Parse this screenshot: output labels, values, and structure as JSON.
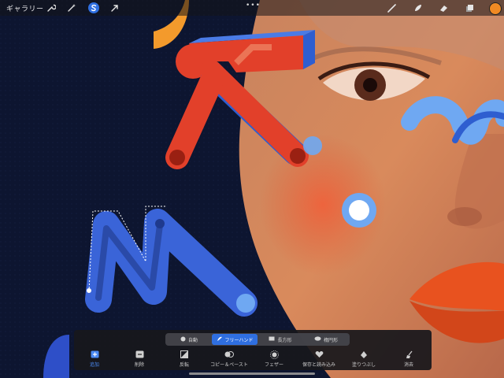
{
  "topbar": {
    "gallery_label": "ギャラリー",
    "more_label": "•••"
  },
  "icons": {
    "adjust": "wrench-icon",
    "actions": "magic-wand-icon",
    "selection": "selection-s-icon",
    "transform": "arrow-cursor-icon",
    "brush": "brush-icon",
    "smudge": "smudge-icon",
    "eraser": "eraser-icon",
    "layers": "layers-icon"
  },
  "colors": {
    "accent": "#2f6fe0",
    "current_color": "#f08a24"
  },
  "selection_modes": [
    {
      "label": "自動",
      "icon": "circle-icon",
      "active": false
    },
    {
      "label": "フリーハンド",
      "icon": "freehand-icon",
      "active": true
    },
    {
      "label": "長方形",
      "icon": "rectangle-icon",
      "active": false
    },
    {
      "label": "楕円形",
      "icon": "ellipse-icon",
      "active": false
    }
  ],
  "selection_actions": [
    {
      "label": "追加",
      "icon": "add-icon",
      "active": true
    },
    {
      "label": "削除",
      "icon": "remove-icon",
      "active": false
    },
    {
      "label": "反転",
      "icon": "invert-icon",
      "active": false
    },
    {
      "label": "コピー＆ペースト",
      "icon": "copy-paste-icon",
      "active": false
    },
    {
      "label": "フェザー",
      "icon": "feather-icon",
      "active": false
    },
    {
      "label": "保存と読み込み",
      "icon": "save-load-icon",
      "active": false
    },
    {
      "label": "塗りつぶし",
      "icon": "fill-icon",
      "active": false
    },
    {
      "label": "消去",
      "icon": "clear-icon",
      "active": false
    }
  ]
}
